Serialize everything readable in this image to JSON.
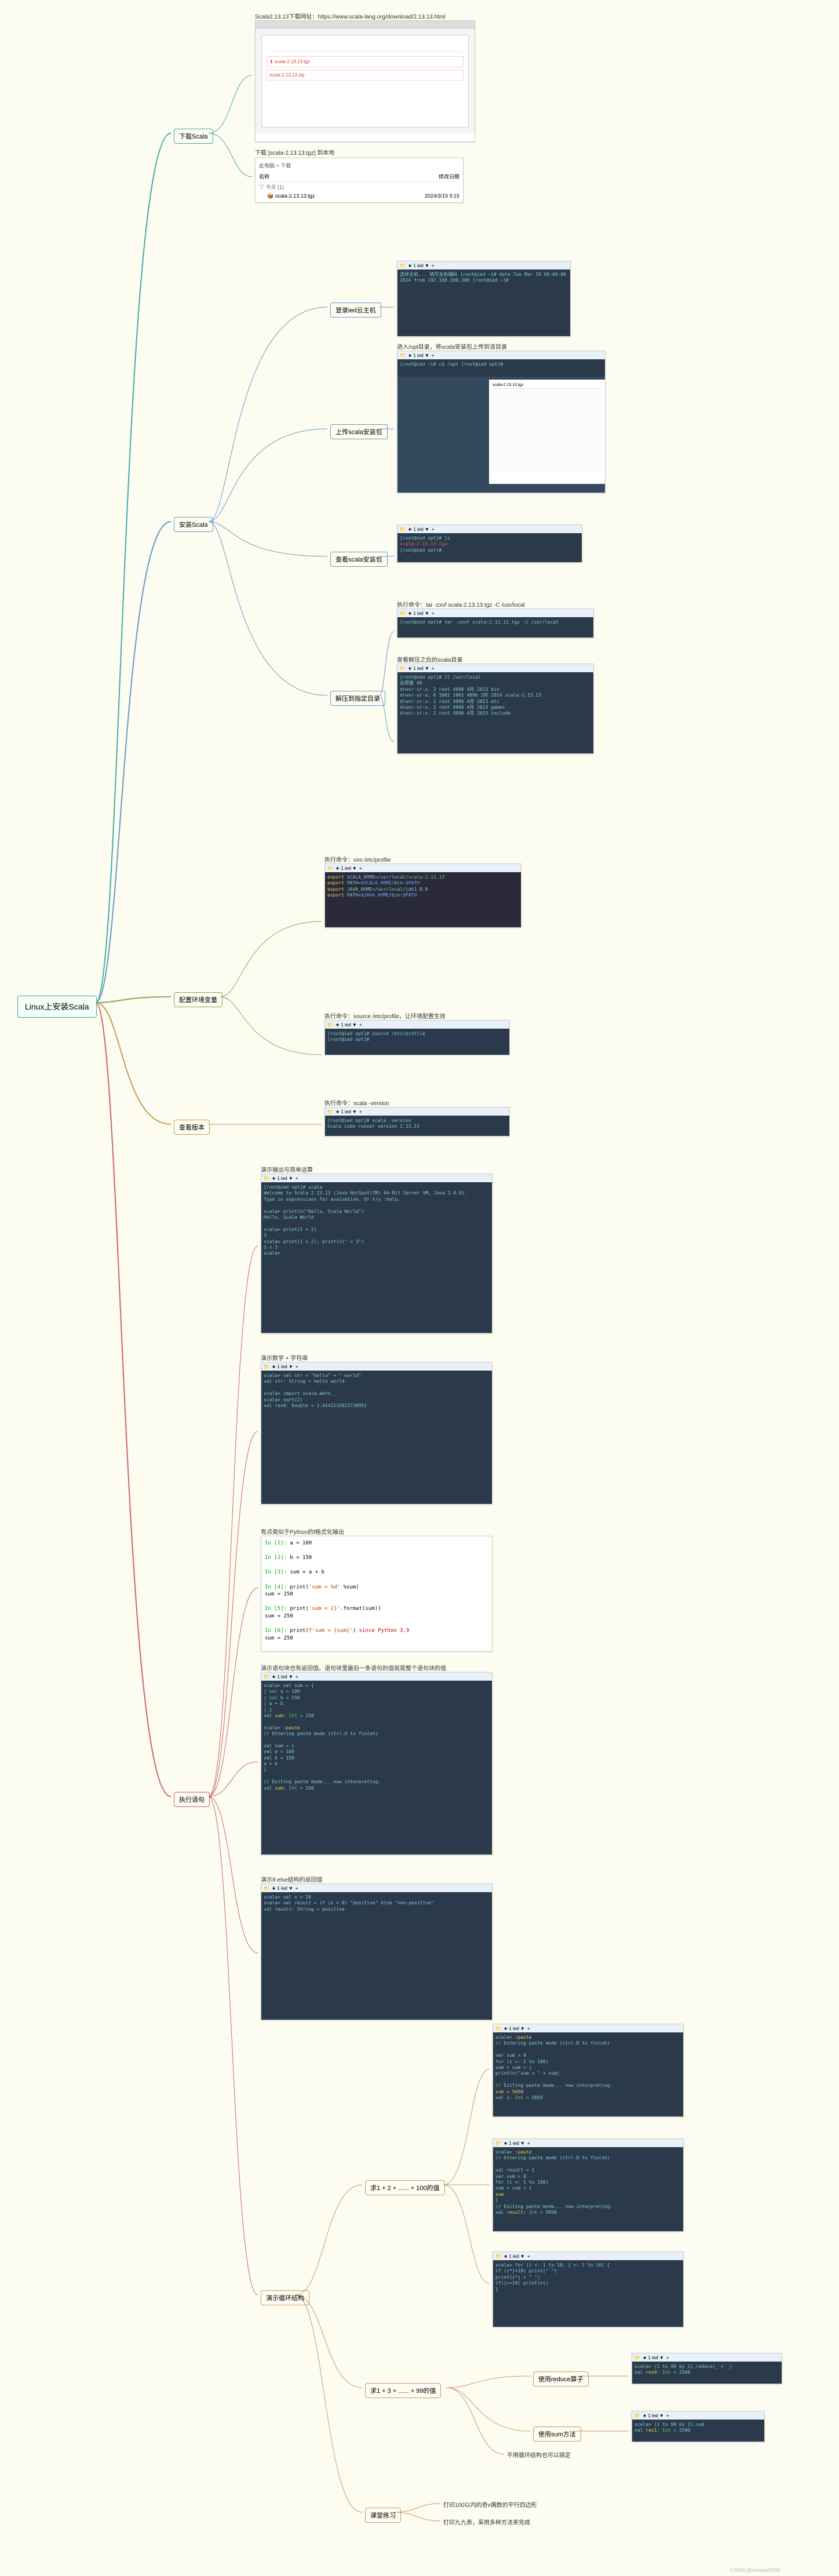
{
  "root": {
    "label": "Linux上安装Scala"
  },
  "b1": {
    "label": "下载Scala",
    "url": "Scala2.13.13下载网址：https://www.scala-lang.org/download/2.13.13.html",
    "dl": "下载 [scala-2.13.13.tgz] 到本地",
    "fhead": "此电脑 > 下载",
    "fc1": "名称",
    "fc2": "修改日期",
    "ffold": "今天 (1)",
    "ffile": "scala-2.13.13.tgz",
    "fdate": "2024/3/19 9:15"
  },
  "b2": {
    "label": "安装Scala",
    "s1": {
      "label": "登录ied云主机",
      "t": "选择主机...\n填写主机编码\n[root@ied ~]# date\nTue Mar 19 09:00:06 2024 from 192.168.100.200\n[root@ied ~]#"
    },
    "s2": {
      "label": "上传scala安装包",
      "title": "进入/opt目录，将scala安装包上传到该目录",
      "t": "[root@ied ~]# cd /opt\n[root@ied opt]#"
    },
    "s3": {
      "label": "查看scala安装包",
      "t": "[root@ied opt]# ls\nscala-2.13.13.tgz\n[root@ied opt]#",
      "red": "scala-2.13.13.tgz"
    },
    "s4": {
      "label": "解压到指定目录",
      "title1": "执行命令：tar -zxvf scala-2.13.13.tgz -C /usr/local",
      "t1": "[root@ied opt]# tar -zxvf scala-2.13.13.tgz -C /usr/local",
      "title2": "查看解压之后的scala目录",
      "t2": "[root@ied opt]# ll /usr/local\n总用量 48\ndrwxr-xr-x. 2 root 4096 4月  2023 bin\ndrwxr-xr-x. 6 1001 1001 4096 3月  2024 scala-2.13.13\ndrwxr-xr-x. 2 root 4096 4月  2023 etc\ndrwxr-xr-x. 2 root 4096 4月  2023 games\ndrwxr-xr-x. 2 root 4096 4月  2023 include"
    }
  },
  "b3": {
    "label": "配置环境变量",
    "title1": "执行命令：vim /etc/profile",
    "t1": "export SCALA_HOME=/usr/local/scala-2.13.13\nexport PATH=$SCALA_HOME/bin:$PATH\nexport JAVA_HOME=/usr/local/jdk1.8.0\nexport PATH=$JAVA_HOME/bin:$PATH",
    "title2": "执行命令：source /etc/profile，让环境配置生效",
    "t2": "[root@ied opt]# source /etc/profile\n[root@ied opt]#"
  },
  "b4": {
    "label": "查看版本",
    "title": "执行命令：scala -version"
  },
  "b5": {
    "label": "执行语句",
    "s1": {
      "title": "演示输出与简单运算",
      "t": "[root@ied opt]# scala\nWelcome to Scala 2.13.13 (Java HotSpot(TM) 64-Bit Server VM, Java 1.8.0).\nType in expressions for evaluation. Or try :help.\n\nscala> println(\"Hello, Scala World\")\nHello, Scala World\n\nscala> print(1 + 2)\n3\nscala> print(1 + 2); println(\" = 3\")\n3 = 3\nscala>"
    },
    "s2": {
      "title": "演示数学 + 字符串"
    },
    "s3": {
      "title": "有点类似于Python的f格式化输出",
      "code": "In [1]: a = 100\n\nIn [2]: b = 150\n\nIn [3]: sum = a + b\n\nIn [4]: print('sum = %d' %sum)\nsum = 250\n\nIn [5]: print('sum = {}'.format(sum))\nsum = 250\n\nIn [6]: print(f'sum = {sum}') since Python 3.9\nsum = 250"
    },
    "s4": {
      "title": "演示语句块也有返回值。语句块里最后一条语句的值就是整个语句块的值",
      "t": "scala> val sum = {\n     |   val a = 100\n     |   val b = 150\n     |   a + b\n     | }\nval sum: Int = 250\n\nscala> :paste\n// Entering paste mode (ctrl-D to finish)\n\nval sum = {\n  val a = 100\n  val b = 150\n  a + b\n}\n\n// Exiting paste mode... now interpreting.\nval sum: Int = 250"
    },
    "s5": {
      "title": "演示if-else结构的返回值"
    },
    "s6": {
      "title": "演示循环结构",
      "sum100": {
        "title": "求1 + 2 + ...... + 100的值",
        "t1": "scala> :paste\n// Entering paste mode (ctrl-D to finish)\n\nvar sum = 0\nfor (i <- 1 to 100)\n  sum = sum + i\nprintln(\"sum = \" + sum)\n\n// Exiting paste mode... now interpreting.\nsum = 5050\nval i: Int = 5050",
        "t2": "scala> :paste\n// Entering paste mode (ctrl-D to finish)\n\nval result = {\n  var sum = 0\n  for (i <- 1 to 100)\n    sum = sum + i\n  sum\n}\n// Exiting paste mode... now interpreting.\nval result: Int = 5050",
        "t3": "scala> for (i <- 1 to 10; j <- 1 to 10) {\n  if (i*j<10) print(\" \")\n  print(i*j + \" \")\n  if(j==10) println()\n}"
      },
      "sum99": {
        "title": "求1 + 3 + ...... + 99的值",
        "r": {
          "label": "使用reduce算子",
          "t": "scala> (1 to 99 by 2).reduce(_ + _)\nval res0: Int = 2500"
        },
        "sm": {
          "label": "使用sum方法",
          "t": "scala> (1 to 99 by 2).sum\nval res1: Int = 2500"
        },
        "note": "不用循环结构也可以搞定"
      },
      "hw": {
        "label": "课堂练习",
        "i1": "打印100以内的奇x偶数的平行四边形",
        "i2": "打印九九表，采用多种方法来完成"
      }
    }
  },
  "tb": "★ 1 ied ▼",
  "plus": "+"
}
